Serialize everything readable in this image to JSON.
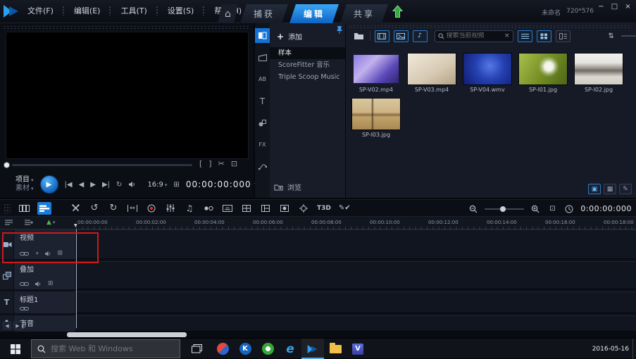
{
  "app": {
    "project_name": "未命名",
    "resolution": "720*576",
    "accent_color": "#1e8fe8"
  },
  "menubar": {
    "items": [
      {
        "label": "文件(F)"
      },
      {
        "label": "编辑(E)"
      },
      {
        "label": "工具(T)"
      },
      {
        "label": "设置(S)"
      },
      {
        "label": "帮助(H)"
      }
    ]
  },
  "tabs": {
    "capture": "捕获",
    "edit": "编辑",
    "share": "共享"
  },
  "preview": {
    "project_label": "项目",
    "clip_label": "素材",
    "aspect_ratio": "16:9",
    "timecode": "00:00:00:000"
  },
  "library": {
    "add_label": "添加",
    "categories": [
      {
        "label": "样本"
      },
      {
        "label": "ScoreFitter 音乐"
      },
      {
        "label": "Triple Scoop Music"
      }
    ],
    "browse_label": "浏览",
    "icon_labels": {
      "transition": "AB",
      "title": "T",
      "filter": "FX"
    }
  },
  "gallery": {
    "search_placeholder": "搜索当前视频",
    "items": [
      {
        "name": "SP-V02.mp4"
      },
      {
        "name": "SP-V03.mp4"
      },
      {
        "name": "SP-V04.wmv"
      },
      {
        "name": "SP-I01.jpg"
      },
      {
        "name": "SP-I02.jpg"
      },
      {
        "name": "SP-I03.jpg"
      }
    ]
  },
  "toolbar": {
    "labels": {
      "t3d": "T3D"
    },
    "timecode": "0:00:00:000"
  },
  "timeline": {
    "ruler_labels": [
      "00:00:00:00",
      "00:00:02:00",
      "00:00:04:00",
      "00:00:06:00",
      "00:00:08:00",
      "00:00:10:00",
      "00:00:12:00",
      "00:00:14:00",
      "00:00:16:00",
      "00:00:18:00"
    ],
    "tracks": [
      {
        "label": "视频"
      },
      {
        "label": "叠加"
      },
      {
        "label": "标题1"
      },
      {
        "label": "声音"
      }
    ]
  },
  "taskbar": {
    "search_placeholder": "搜索 Web 和 Windows",
    "date": "2016-05-16"
  }
}
